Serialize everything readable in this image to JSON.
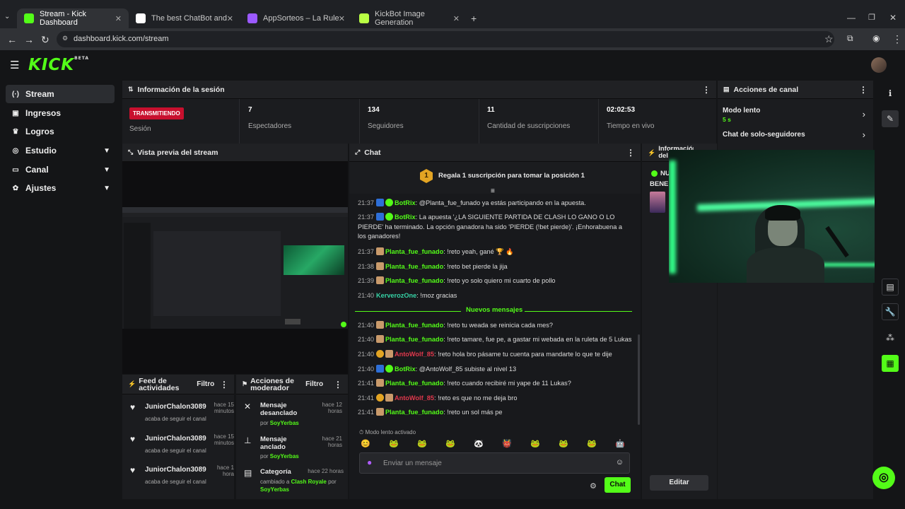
{
  "browser": {
    "tabs": [
      {
        "title": "Stream - Kick Dashboard",
        "active": true,
        "color": "#53fc18"
      },
      {
        "title": "The best ChatBot and Widgets",
        "active": false,
        "color": "#ffffff"
      },
      {
        "title": "AppSorteos – La Ruleta de la Su",
        "active": false,
        "color": "#9b59ff"
      },
      {
        "title": "KickBot Image Generation",
        "active": false,
        "color": "#b9ff44"
      }
    ],
    "url": "dashboard.kick.com/stream"
  },
  "app": {
    "logo": "KICK",
    "logo_tag": "BETA",
    "accent": "#53fc18"
  },
  "sidebar": {
    "items": [
      {
        "label": "Stream",
        "icon": "broadcast-icon",
        "glyph": "(·)"
      },
      {
        "label": "Ingresos",
        "icon": "revenue-icon",
        "glyph": "▣"
      },
      {
        "label": "Logros",
        "icon": "trophy-icon",
        "glyph": "♛"
      },
      {
        "label": "Estudio",
        "icon": "studio-icon",
        "glyph": "◎"
      },
      {
        "label": "Canal",
        "icon": "channel-icon",
        "glyph": "▭"
      },
      {
        "label": "Ajustes",
        "icon": "settings-icon",
        "glyph": "✿"
      }
    ]
  },
  "session": {
    "title": "Información de la sesión",
    "badge": "TRANSMITIENDO",
    "badge_label": "Sesión",
    "stats": [
      {
        "value": "7",
        "label": "Espectadores"
      },
      {
        "value": "134",
        "label": "Seguidores"
      },
      {
        "value": "11",
        "label": "Cantidad de suscripciones"
      },
      {
        "value": "02:02:53",
        "label": "Tiempo en vivo"
      }
    ]
  },
  "channel_actions": {
    "title": "Acciones de canal",
    "slow_mode": "Modo lento",
    "slow_mode_value": "5 s",
    "followers_only": "Chat de solo-seguidores"
  },
  "preview": {
    "title": "Vista previa del stream"
  },
  "chat": {
    "title": "Chat",
    "pinned": "Regala 1 suscripción para tomar la posición 1",
    "pinned_rank": "1",
    "messages": [
      {
        "time": "21:37",
        "user": "BotRix",
        "text": ": @Planta_fue_funado ya estás participando en la apuesta.",
        "color": "#53fc18",
        "badges": [
          "bot",
          "verified"
        ]
      },
      {
        "time": "21:37",
        "user": "BotRix",
        "text": ": La apuesta '¿LA SIGUIENTE PARTIDA DE CLASH LO GANO O LO PIERDE' ha terminado. La opción ganadora ha sido 'PIERDE (!bet pierde)'. ¡Enhorabuena a los ganadores!",
        "color": "#53fc18",
        "badges": [
          "bot",
          "verified"
        ]
      },
      {
        "time": "21:37",
        "user": "Planta_fue_funado",
        "text": ": !reto yeah, gané 🏆 🔥",
        "color": "#53fc18",
        "badges": [
          "avatar"
        ]
      },
      {
        "time": "21:38",
        "user": "Planta_fue_funado",
        "text": ": !reto bet pierde la jija",
        "color": "#53fc18",
        "badges": [
          "avatar"
        ]
      },
      {
        "time": "21:39",
        "user": "Planta_fue_funado",
        "text": ": !reto yo solo quiero mi cuarto de pollo",
        "color": "#53fc18",
        "badges": [
          "avatar"
        ]
      },
      {
        "time": "21:40",
        "user": "KerverozOne",
        "text": ": !moz gracias",
        "color": "#36d3a6",
        "badges": []
      }
    ],
    "divider": "Nuevos mensajes",
    "new_messages": [
      {
        "time": "21:40",
        "user": "Planta_fue_funado",
        "text": ": !reto tu weada se reinicia cada mes?",
        "color": "#53fc18",
        "badges": [
          "avatar"
        ]
      },
      {
        "time": "21:40",
        "user": "Planta_fue_funado",
        "text": ": !reto tamare, fue pe, a gastar mi webada en la ruleta de 5 Lukas",
        "color": "#53fc18",
        "badges": [
          "avatar"
        ]
      },
      {
        "time": "21:40",
        "user": "AntoWolf_85",
        "text": ": !reto hola bro pásame tu cuenta para mandarte lo que te dije",
        "color": "#e0384c",
        "badges": [
          "gift",
          "avatar"
        ]
      },
      {
        "time": "21:40",
        "user": "BotRix",
        "text": ": @AntoWolf_85 subiste al nivel 13",
        "color": "#53fc18",
        "badges": [
          "bot",
          "verified"
        ]
      },
      {
        "time": "21:41",
        "user": "Planta_fue_funado",
        "text": ": !reto cuando recibiré mi yape de 11 Lukas?",
        "color": "#53fc18",
        "badges": [
          "avatar"
        ]
      },
      {
        "time": "21:41",
        "user": "AntoWolf_85",
        "text": ": !reto es que no me deja bro",
        "color": "#e0384c",
        "badges": [
          "gift",
          "avatar"
        ]
      },
      {
        "time": "21:41",
        "user": "Planta_fue_funado",
        "text": ": !reto un sol más pe",
        "color": "#53fc18",
        "badges": [
          "avatar"
        ]
      }
    ],
    "slow_notice": "Modo lento activado",
    "emotes": [
      "😊",
      "🐸",
      "🐸",
      "🐸",
      "🐼",
      "👹",
      "🐸",
      "🐸",
      "🐸",
      "🤖"
    ],
    "input_placeholder": "Enviar un mensaje",
    "send_label": "Chat"
  },
  "activity": {
    "title": "Feed de actividades",
    "filter": "Filtro",
    "items": [
      {
        "name": "JuniorChalon3089",
        "time": "hace 15 minutos",
        "action": "acaba de seguir el canal"
      },
      {
        "name": "JuniorChalon3089",
        "time": "hace 15 minutos",
        "action": "acaba de seguir el canal"
      },
      {
        "name": "JuniorChalon3089",
        "time": "hace 1 hora",
        "action": "acaba de seguir el canal"
      }
    ]
  },
  "moderator": {
    "title": "Acciones de moderador",
    "filter": "Filtro",
    "items": [
      {
        "title": "Mensaje desanclado",
        "time": "hace 12 horas",
        "by_prefix": "por",
        "by": "SoyYerbas",
        "icon": "unpin-icon",
        "glyph": "✕"
      },
      {
        "title": "Mensaje anclado",
        "time": "hace 21 horas",
        "by_prefix": "por",
        "by": "SoyYerbas",
        "icon": "pin-icon",
        "glyph": "⊥"
      },
      {
        "title": "Categoría",
        "time": "hace 22 horas",
        "by_prefix": "cambiado a",
        "by": "Clash Royale",
        "by_suffix": "por",
        "by2": "SoyYerbas",
        "icon": "category-icon",
        "glyph": "▤"
      }
    ]
  },
  "info_panel": {
    "title": "Información del s",
    "line1": "NU",
    "line2": "BENE",
    "edit_label": "Editar"
  }
}
